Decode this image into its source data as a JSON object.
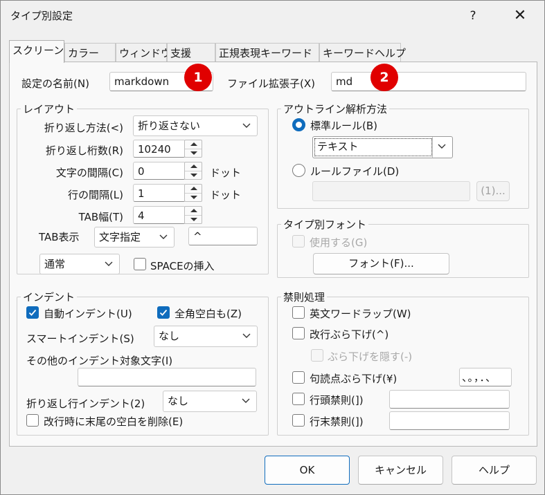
{
  "window": {
    "title": "タイプ別設定",
    "help_glyph": "?",
    "close_glyph": "✕"
  },
  "tabs": [
    {
      "label": "スクリーン",
      "active": true
    },
    {
      "label": "カラー"
    },
    {
      "label": "ウィンドウ"
    },
    {
      "label": "支援"
    },
    {
      "label": "正規表現キーワード"
    },
    {
      "label": "キーワードヘルプ"
    }
  ],
  "settings_name": {
    "label": "設定の名前(N)",
    "value": "markdown",
    "badge": "1"
  },
  "file_ext": {
    "label": "ファイル拡張子(X)",
    "value": "md",
    "badge": "2"
  },
  "layout": {
    "title": "レイアウト",
    "wrap_method": {
      "label": "折り返し方法(<)",
      "value": "折り返さない"
    },
    "wrap_columns": {
      "label": "折り返し桁数(R)",
      "value": "10240"
    },
    "char_spacing": {
      "label": "文字の間隔(C)",
      "value": "0",
      "unit": "ドット"
    },
    "line_spacing": {
      "label": "行の間隔(L)",
      "value": "1",
      "unit": "ドット"
    },
    "tab_width": {
      "label": "TAB幅(T)",
      "value": "4"
    },
    "tab_display": {
      "label": "TAB表示",
      "mode": "文字指定",
      "char": "^"
    },
    "mode_select": {
      "value": "通常"
    },
    "space_insert": {
      "label": "SPACEの挿入",
      "checked": false
    }
  },
  "outline": {
    "title": "アウトライン解析方法",
    "standard_rule": {
      "label": "標準ルール(B)",
      "selected": true
    },
    "standard_select": {
      "value": "テキスト"
    },
    "rule_file": {
      "label": "ルールファイル(D)",
      "selected": false
    },
    "rule_file_input": {
      "value": ""
    },
    "browse_button": "(1)..."
  },
  "type_font": {
    "title": "タイプ別フォント",
    "use": {
      "label": "使用する(G)",
      "checked": false
    },
    "font_button": "フォント(F)..."
  },
  "indent": {
    "title": "インデント",
    "auto_indent": {
      "label": "自動インデント(U)",
      "checked": true
    },
    "fullwidth_space": {
      "label": "全角空白も(Z)",
      "checked": true
    },
    "smart_indent": {
      "label": "スマートインデント(S)",
      "value": "なし"
    },
    "other_chars": {
      "label": "その他のインデント対象文字(I)",
      "value": ""
    },
    "wrap_indent": {
      "label": "折り返し行インデント(2)",
      "value": "なし"
    },
    "trim_trailing": {
      "label": "改行時に末尾の空白を削除(E)",
      "checked": false
    }
  },
  "kinsoku": {
    "title": "禁則処理",
    "word_wrap": {
      "label": "英文ワードラップ(W)",
      "checked": false
    },
    "line_hang": {
      "label": "改行ぶら下げ(^)",
      "checked": false
    },
    "hide_hang": {
      "label": "ぶら下げを隠す(-)",
      "checked": false
    },
    "punct_hang": {
      "label": "句読点ぶら下げ(¥)",
      "checked": false,
      "value": "、。，．、"
    },
    "head_kinsoku": {
      "label": "行頭禁則(])",
      "checked": false,
      "value": ""
    },
    "tail_kinsoku": {
      "label": "行末禁則(])",
      "checked": false,
      "value": ""
    }
  },
  "buttons": {
    "ok": "OK",
    "cancel": "キャンセル",
    "help": "ヘルプ"
  },
  "colors": {
    "accent": "#0f6cbd",
    "badge": "#e00000"
  }
}
